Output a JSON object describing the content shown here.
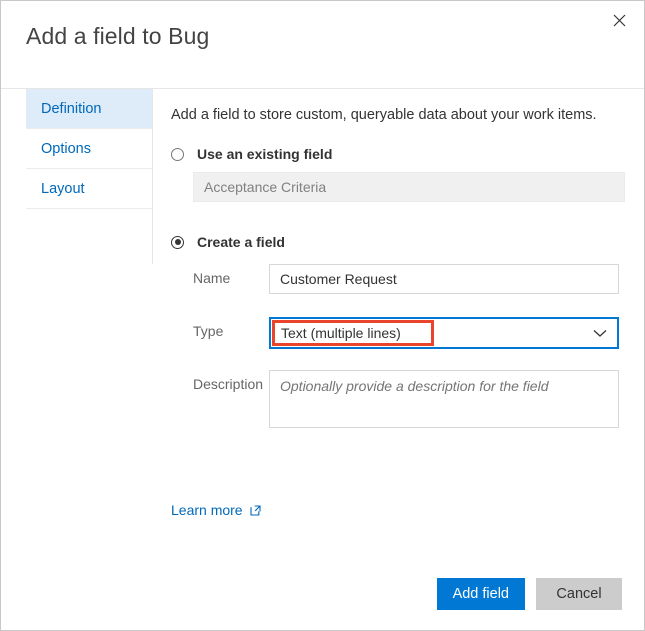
{
  "dialog": {
    "title": "Add a field to Bug",
    "close_icon": "close-icon"
  },
  "sidebar": {
    "items": [
      {
        "label": "Definition",
        "selected": true
      },
      {
        "label": "Options",
        "selected": false
      },
      {
        "label": "Layout",
        "selected": false
      }
    ]
  },
  "content": {
    "description": "Add a field to store custom, queryable data about your work items.",
    "existing_field": {
      "radio_label": "Use an existing field",
      "selected": false,
      "combo_value": "Acceptance Criteria"
    },
    "create_field": {
      "radio_label": "Create a field",
      "selected": true,
      "name": {
        "label": "Name",
        "value": "Customer Request"
      },
      "type": {
        "label": "Type",
        "value": "Text (multiple lines)",
        "chevron_icon": "chevron-down-icon",
        "highlighted": true,
        "highlight_color": "#e8452c"
      },
      "description": {
        "label": "Description",
        "placeholder": "Optionally provide a description for the field",
        "value": ""
      }
    },
    "learn_more": {
      "label": "Learn more",
      "icon": "external-link-icon"
    }
  },
  "footer": {
    "primary_label": "Add field",
    "secondary_label": "Cancel"
  },
  "colors": {
    "accent": "#0078d4",
    "link": "#0069ba",
    "selected_tab_bg": "#deecf9",
    "annotation": "#e8452c"
  }
}
